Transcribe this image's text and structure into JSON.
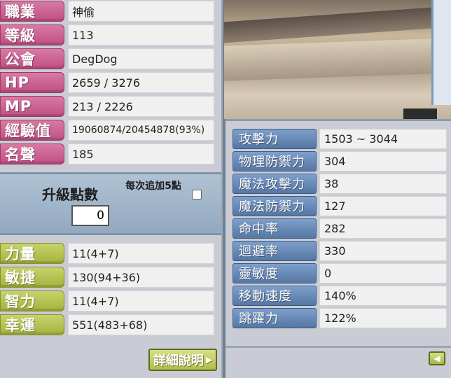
{
  "profile": [
    {
      "label": "職業",
      "value": "神偷"
    },
    {
      "label": "等級",
      "value": "113"
    },
    {
      "label": "公會",
      "value": "DegDog"
    },
    {
      "label": "HP",
      "value": "2659 / 3276"
    },
    {
      "label": "MP",
      "value": "213 / 2226"
    },
    {
      "label": "經驗值",
      "value": "19060874/20454878(93%)"
    },
    {
      "label": "名聲",
      "value": "185"
    }
  ],
  "ability_points": {
    "title": "升級點數",
    "value": "0",
    "auto_add_label": "每次追加5點"
  },
  "base_stats": [
    {
      "label": "力量",
      "value": "11(4+7)"
    },
    {
      "label": "敏捷",
      "value": "130(94+36)"
    },
    {
      "label": "智力",
      "value": "11(4+7)"
    },
    {
      "label": "幸運",
      "value": "551(483+68)"
    }
  ],
  "detail_button_label": "詳細說明",
  "detailed_stats": [
    {
      "label": "攻擊力",
      "value": "1503 ~ 3044"
    },
    {
      "label": "物理防禦力",
      "value": "304"
    },
    {
      "label": "魔法攻擊力",
      "value": "38"
    },
    {
      "label": "魔法防禦力",
      "value": "127"
    },
    {
      "label": "命中率",
      "value": "282"
    },
    {
      "label": "迴避率",
      "value": "330"
    },
    {
      "label": "靈敏度",
      "value": "0"
    },
    {
      "label": "移動速度",
      "value": "140%"
    },
    {
      "label": "跳躍力",
      "value": "122%"
    }
  ],
  "colors": {
    "profile_label": "#c8588c",
    "stat_label": "#aab744",
    "detail_label": "#5f80ad",
    "panel_bg": "#c9ccd4"
  }
}
